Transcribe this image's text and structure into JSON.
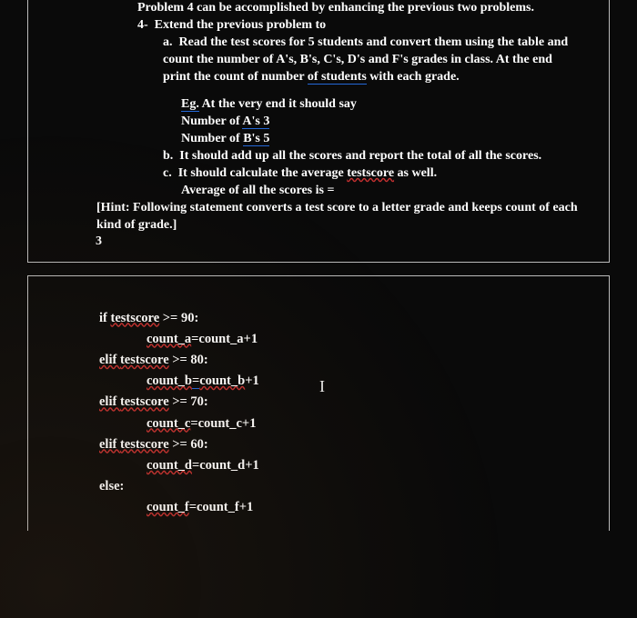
{
  "problem": {
    "intro": "Problem 4 can be accomplished by enhancing the previous two problems.",
    "num": "4-",
    "title": "Extend the previous problem to",
    "a_label": "a.",
    "a_text1": "Read the test scores for 5 students and convert them using the table and count the number of A's, B's, C's, D's and F's grades in class. At the end print the count of number ",
    "a_text_ul": "of  students",
    "a_text2": " with each grade.",
    "eg_label": "Eg.",
    "eg_text": " At the very end it should say",
    "numA_pre": "Number of ",
    "numA_ul": "A's  3",
    "numB_pre": "Number of ",
    "numB_ul": "B's  5",
    "b_label": "b.",
    "b_text": "It should add up all the scores and report the total of all the scores.",
    "c_label": "c.",
    "c_text1": "It should calculate the average ",
    "c_text_ul": "testscore",
    "c_text2": " as well.",
    "c_avg": "Average of all the scores is =",
    "hint": "[Hint: Following statement converts a test score to a letter grade and keeps count of each kind of grade.]",
    "page_num": "3"
  },
  "code": {
    "l1_pre": "if ",
    "l1_ul": "testscore",
    "l1_post": " >= 90:",
    "l2_ul": "count_a",
    "l2_post": "=count_a+1",
    "l3_pre": "elif ",
    "l3_ul": "testscore",
    "l3_post": " >= 80:",
    "l4_pre": "count_b",
    "l4_mid": "=",
    "l4_ul2": "count_b",
    "l4_post": "+1",
    "l5_pre": "elif ",
    "l5_ul": "testscore",
    "l5_post": " >= 70:",
    "l6_ul": "count_c",
    "l6_post": "=count_c+1",
    "l7_pre": "elif ",
    "l7_ul": "testscore",
    "l7_post": " >= 60:",
    "l8_ul": "count_d",
    "l8_post": "=count_d+1",
    "l9": "else:",
    "l10_ul": "count_f",
    "l10_post": "=count_f+1"
  },
  "cursor_glyph": "I"
}
